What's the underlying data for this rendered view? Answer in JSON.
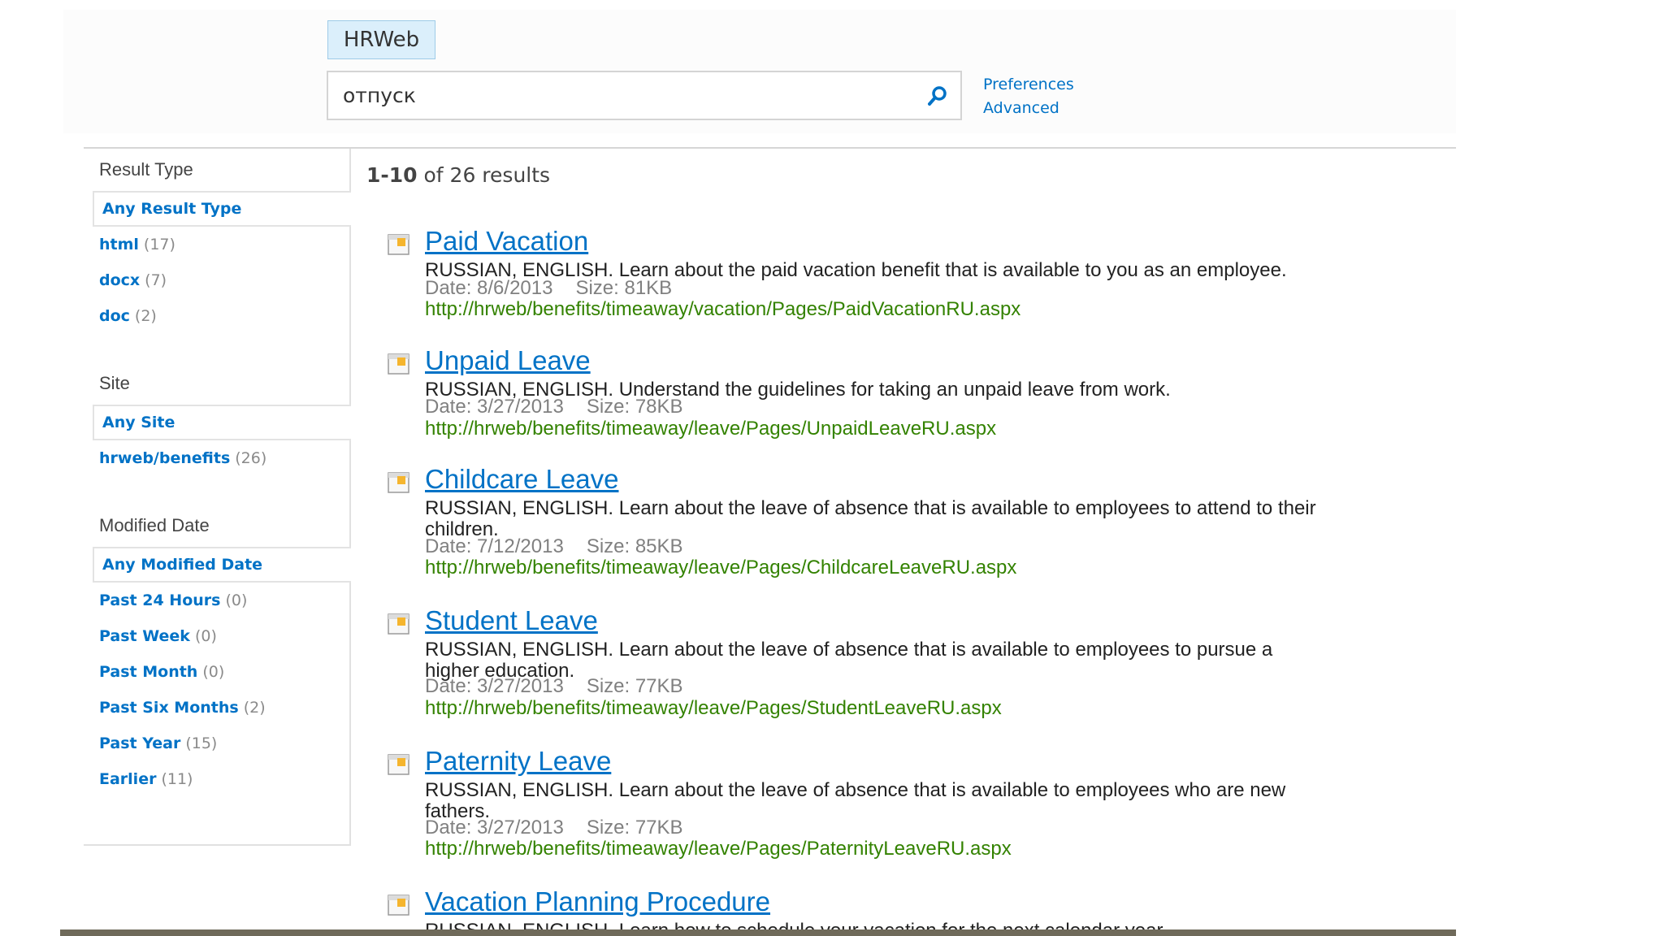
{
  "header": {
    "scope_tab": "HRWeb",
    "search_value": "отпуск",
    "preferences_link": "Preferences",
    "advanced_link": "Advanced"
  },
  "results_summary": {
    "range": "1-10",
    "rest": " of 26 results"
  },
  "refiners": [
    {
      "title": "Result Type",
      "selected": "Any Result Type",
      "items": [
        {
          "label": "html",
          "count": "(17)"
        },
        {
          "label": "docx",
          "count": "(7)"
        },
        {
          "label": "doc",
          "count": "(2)"
        }
      ]
    },
    {
      "title": "Site",
      "selected": "Any Site",
      "items": [
        {
          "label": "hrweb/benefits",
          "count": "(26)"
        }
      ]
    },
    {
      "title": "Modified Date",
      "selected": "Any Modified Date",
      "items": [
        {
          "label": "Past 24 Hours",
          "count": "(0)"
        },
        {
          "label": "Past Week",
          "count": "(0)"
        },
        {
          "label": "Past Month",
          "count": "(0)"
        },
        {
          "label": "Past Six Months",
          "count": "(2)"
        },
        {
          "label": "Past Year",
          "count": "(15)"
        },
        {
          "label": "Earlier",
          "count": "(11)"
        }
      ]
    }
  ],
  "results": [
    {
      "title": "Paid Vacation",
      "summary": "RUSSIAN, ENGLISH. Learn about the paid vacation benefit that is available to you as an employee.",
      "date": "Date: 8/6/2013",
      "size": "Size: 81KB",
      "url": "http://hrweb/benefits/timeaway/vacation/Pages/PaidVacationRU.aspx"
    },
    {
      "title": "Unpaid Leave",
      "summary": "RUSSIAN, ENGLISH. Understand the guidelines for taking an unpaid leave from work.",
      "date": "Date: 3/27/2013",
      "size": "Size: 78KB",
      "url": "http://hrweb/benefits/timeaway/leave/Pages/UnpaidLeaveRU.aspx"
    },
    {
      "title": "Childcare Leave",
      "summary": "RUSSIAN, ENGLISH. Learn about the leave of absence that is available to employees to attend to their children.",
      "date": "Date: 7/12/2013",
      "size": "Size: 85KB",
      "url": "http://hrweb/benefits/timeaway/leave/Pages/ChildcareLeaveRU.aspx"
    },
    {
      "title": "Student Leave",
      "summary": "RUSSIAN, ENGLISH. Learn about the leave of absence that is available to employees to pursue a higher education.",
      "date": "Date: 3/27/2013",
      "size": "Size: 77KB",
      "url": "http://hrweb/benefits/timeaway/leave/Pages/StudentLeaveRU.aspx"
    },
    {
      "title": "Paternity Leave",
      "summary": "RUSSIAN, ENGLISH. Learn about the leave of absence that is available to employees who are new fathers.",
      "date": "Date: 3/27/2013",
      "size": "Size: 77KB",
      "url": "http://hrweb/benefits/timeaway/leave/Pages/PaternityLeaveRU.aspx"
    },
    {
      "title": "Vacation Planning Procedure",
      "summary": "RUSSIAN, ENGLISH. Learn how to schedule your vacation for the next calendar year."
    }
  ],
  "icons": {
    "search": "search-icon",
    "result": "page-icon"
  },
  "colors": {
    "link": "#0072c6",
    "url": "#338200",
    "scope_tab_bg": "#dbeffb"
  }
}
